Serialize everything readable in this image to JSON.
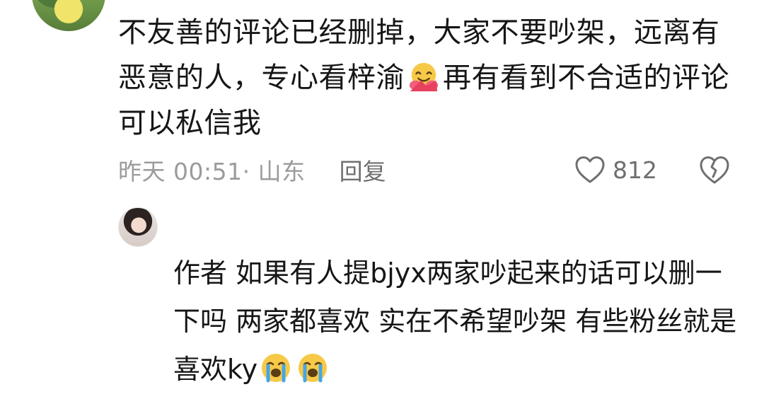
{
  "top_comment": {
    "text_part1": "不友善的评论已经删掉，大家不要吵架，远离有恶意的人，专心看梓渝",
    "emoji_name": "hugging-face",
    "text_part2": "再有看到不合适的评论可以私信我",
    "time_location": "昨天 00:51· 山东",
    "reply_label": "回复",
    "like_count": "812"
  },
  "reply": {
    "text": "作者 如果有人提bjyx两家吵起来的话可以删一下吗 两家都喜欢 实在不希望吵架 有些粉丝就是喜欢ky",
    "emojis": [
      "crying-face",
      "crying-face"
    ]
  }
}
